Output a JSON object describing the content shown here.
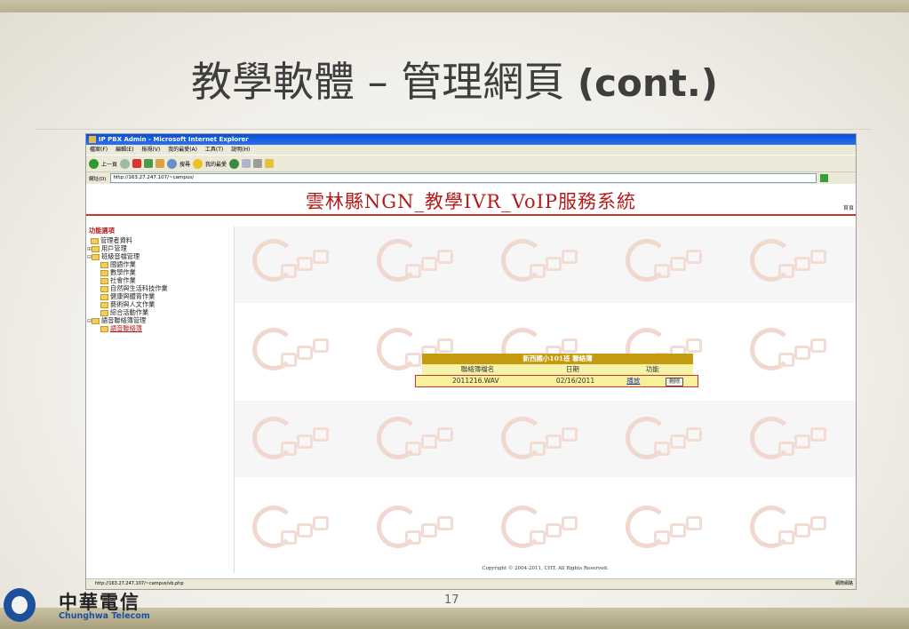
{
  "slide": {
    "title_cn": "教學軟體 – 管理網頁",
    "title_en": "(cont.)",
    "page_number": "17"
  },
  "browser": {
    "window_title": "IP PBX Admin - Microsoft Internet Explorer",
    "menu": [
      "檔案(F)",
      "編輯(E)",
      "檢視(V)",
      "我的最愛(A)",
      "工具(T)",
      "說明(H)"
    ],
    "toolbar": {
      "back": "上一頁",
      "search": "搜尋",
      "favorites": "我的最愛"
    },
    "address_label": "網址(D)",
    "address_value": "http://163.27.247.107/~campus/",
    "status_url": "http://163.27.247.107/~campus/vb.php",
    "status_zone": "網際網路"
  },
  "app": {
    "title": "雲林縣NGN_教學IVR_VoIP服務系統",
    "home_link": "首頁",
    "sidebar": {
      "heading": "功能選項",
      "items": [
        {
          "label": "管理者資料"
        },
        {
          "label": "用戶管理"
        },
        {
          "label": "班級音檔管理"
        },
        {
          "label": "國語作業"
        },
        {
          "label": "數學作業"
        },
        {
          "label": "社會作業"
        },
        {
          "label": "自然與生活科技作業"
        },
        {
          "label": "健康與體育作業"
        },
        {
          "label": "藝術與人文作業"
        },
        {
          "label": "綜合活動作業"
        },
        {
          "label": "語音聯絡簿管理"
        },
        {
          "label": "語音聯絡簿"
        }
      ]
    },
    "contact_book": {
      "title": "新西國小101班 聯絡簿",
      "headers": [
        "聯絡簿檔名",
        "日期",
        "功能"
      ],
      "rows": [
        {
          "filename": "2011216.WAV",
          "date": "02/16/2011",
          "play": "播放",
          "delete": "刪除"
        }
      ]
    },
    "copyright": "Copyright © 2004-2011, CHT. All Rights Reserved."
  },
  "footer": {
    "logo_cn": "中華電信",
    "logo_en": "Chunghwa Telecom"
  },
  "colors": {
    "accent_red": "#b31b1b",
    "table_header": "#c69a10",
    "table_row": "#f8f19c"
  }
}
